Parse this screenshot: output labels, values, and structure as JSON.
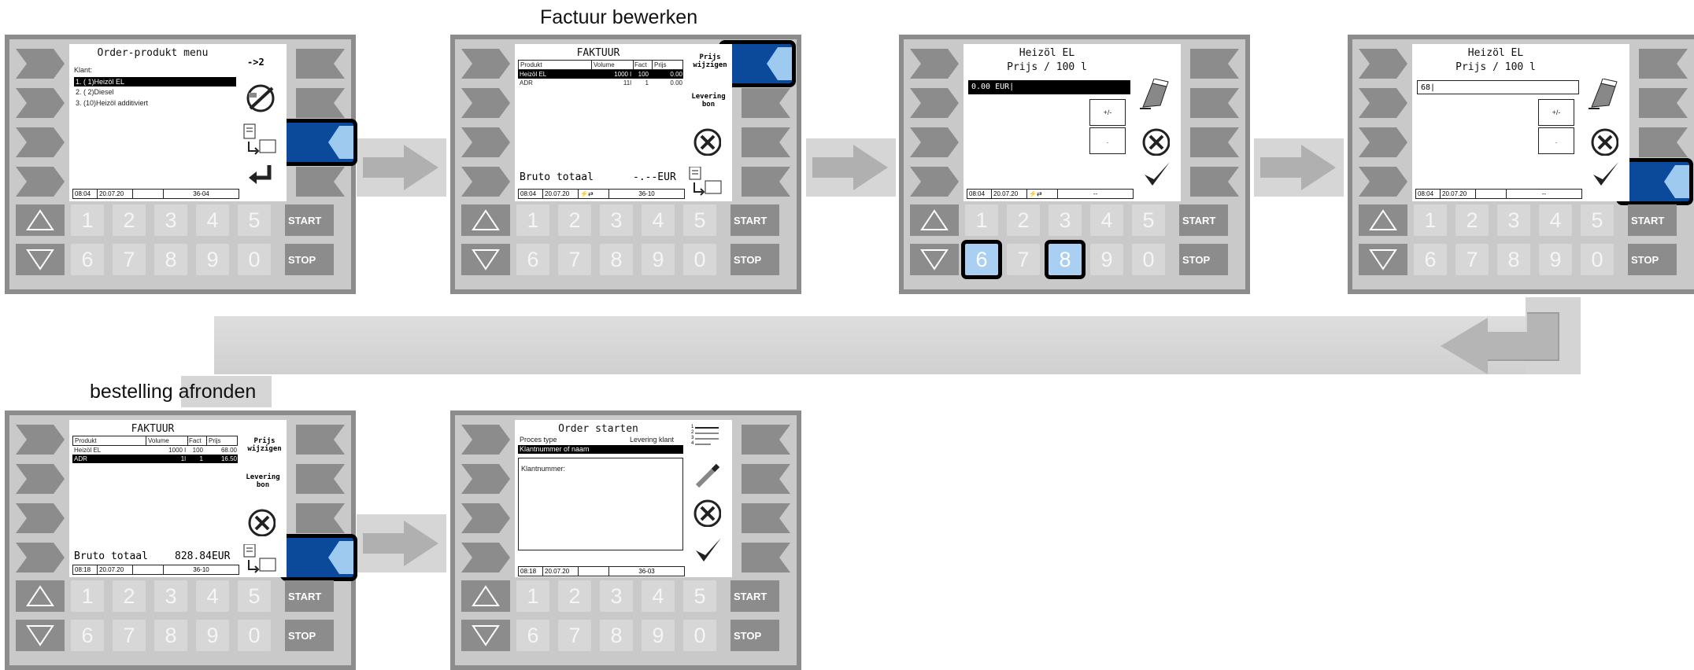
{
  "captions": {
    "factuur_bewerken": "Factuur bewerken",
    "bestelling_afronden": "bestelling afronden"
  },
  "numpad": {
    "row1": [
      "1",
      "2",
      "3",
      "4",
      "5"
    ],
    "row2": [
      "6",
      "7",
      "8",
      "9",
      "0"
    ],
    "start": "START",
    "stop": "STOP"
  },
  "screen1": {
    "title": "Order-produkt menu",
    "arrow_label": "->2",
    "klant_label": "Klant:",
    "items": [
      "1.  ( 1)Heizöl EL",
      "2.  ( 2)Diesel",
      "3.  (10)Heizöl additiviert"
    ],
    "status": [
      "08:04",
      "20.07.20",
      "",
      "36-04"
    ]
  },
  "screen2": {
    "title": "FAKTUUR",
    "headers": [
      "Produkt",
      "Volume",
      "Fact",
      "Prijs"
    ],
    "rows": [
      [
        "Heizöl EL",
        "1000 l",
        "100",
        "0.00"
      ],
      [
        "ADR",
        "11l",
        "1",
        "0.00"
      ]
    ],
    "side1": "Prijs wijzigen",
    "side2": "Levering bon",
    "total_label": "Bruto totaal",
    "total_value": "-.--EUR",
    "status": [
      "08:04",
      "20.07.20",
      "",
      "36-10"
    ]
  },
  "screen3": {
    "title1": "Heizöl EL",
    "title2": "Prijs / 100 l",
    "input": "0.00 EUR|",
    "pm": "+/-",
    "dot": ".",
    "status": [
      "08:04",
      "20.07.20",
      "",
      "--"
    ]
  },
  "screen4": {
    "title1": "Heizöl EL",
    "title2": "Prijs / 100 l",
    "input": "68|",
    "pm": "+/-",
    "dot": ".",
    "status": [
      "08:04",
      "20.07.20",
      "",
      "--"
    ]
  },
  "screen5": {
    "title": "FAKTUUR",
    "headers": [
      "Produkt",
      "Volume",
      "Fact",
      "Prijs"
    ],
    "rows": [
      [
        "Heizöl EL",
        "1000 l",
        "100",
        "68.00"
      ],
      [
        "ADR",
        "1l",
        "1",
        "16.50"
      ]
    ],
    "side1": "Prijs wijzigen",
    "side2": "Levering bon",
    "total_label": "Bruto totaal",
    "total_value": "828.84EUR",
    "status": [
      "08:18",
      "20.07.20",
      "",
      "36-10"
    ]
  },
  "screen6": {
    "title": "Order starten",
    "proces_label": "Proces type",
    "proces_value": "Levering klant",
    "field_hl": "Klantnummer of naam",
    "klantnummer_label": "Klantnummer:",
    "list_digits": [
      "1",
      "2",
      "3",
      "4"
    ],
    "status": [
      "08:18",
      "20.07.20",
      "",
      "36-03"
    ]
  },
  "colors": {
    "panel": "#8c8c8c",
    "frame": "#c9c9c9",
    "active_softkey": "#0b4a9a",
    "active_softkey_light": "#9fcaf0",
    "key_selected": "#a9d0f2",
    "flow_arrow": "#b3b3b3"
  }
}
